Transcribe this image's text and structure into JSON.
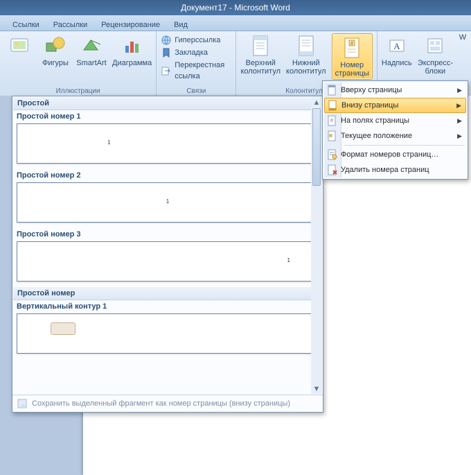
{
  "title": "Документ17 - Microsoft Word",
  "tabs": [
    "Ссылки",
    "Рассылки",
    "Рецензирование",
    "Вид"
  ],
  "ribbon": {
    "illustrations_btns": [
      "",
      "Фигуры",
      "SmartArt",
      "Диаграмма"
    ],
    "illustrations_label": "Иллюстрации",
    "links_btns": [
      "Гиперссылка",
      "Закладка",
      "Перекрестная ссылка"
    ],
    "links_label": "Связи",
    "header_btn": "Верхний\nколонтитул",
    "footer_btn": "Нижний\nколонтитул",
    "pagenum_btn": "Номер\nстраницы",
    "hf_label": "Колонтитулы",
    "textbox_btn": "Надпись",
    "quickparts_btn": "Экспресс-блоки",
    "wordart_btn": "W"
  },
  "menu": {
    "items": [
      {
        "label": "Вверху страницы",
        "sub": true
      },
      {
        "label": "Внизу страницы",
        "sub": true,
        "selected": true
      },
      {
        "label": "На полях страницы",
        "sub": true
      },
      {
        "label": "Текущее положение",
        "sub": true
      },
      {
        "label": "Формат номеров страниц…",
        "sub": false
      },
      {
        "label": "Удалить номера страниц",
        "sub": false
      }
    ]
  },
  "gallery": {
    "group1_header": "Простой",
    "item1": "Простой номер 1",
    "item2": "Простой номер 2",
    "item3": "Простой номер 3",
    "group2_header": "Простой номер",
    "item4": "Вертикальный контур 1",
    "footer": "Сохранить выделенный фрагмент как номер страницы (внизу страницы)"
  }
}
